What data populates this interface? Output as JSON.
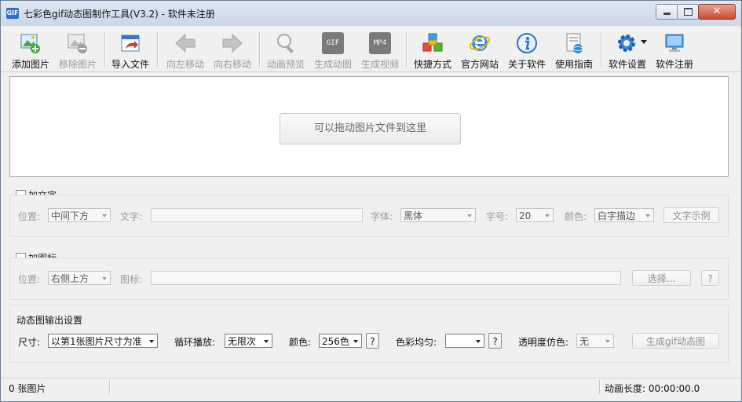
{
  "window": {
    "title": "七彩色gif动态图制作工具(V3.2) - 软件未注册",
    "app_icon_text": "GIF",
    "close_glyph": "✕"
  },
  "toolbar": {
    "items": [
      {
        "label": "添加图片",
        "icon": "add-image-icon"
      },
      {
        "label": "移除图片",
        "icon": "remove-image-icon"
      },
      {
        "label": "导入文件",
        "icon": "import-file-icon"
      },
      {
        "label": "向左移动",
        "icon": "arrow-left-icon"
      },
      {
        "label": "向右移动",
        "icon": "arrow-right-icon"
      },
      {
        "label": "动画预览",
        "icon": "magnifier-icon"
      },
      {
        "label": "生成动图",
        "icon": "gif-icon",
        "badge": "GIF"
      },
      {
        "label": "生成视频",
        "icon": "mp4-icon",
        "badge": "MP4"
      },
      {
        "label": "快捷方式",
        "icon": "cubes-icon"
      },
      {
        "label": "官方网站",
        "icon": "ie-browser-icon"
      },
      {
        "label": "关于软件",
        "icon": "info-icon"
      },
      {
        "label": "使用指南",
        "icon": "guide-icon"
      },
      {
        "label": "软件设置",
        "icon": "gear-icon"
      },
      {
        "label": "软件注册",
        "icon": "monitor-icon"
      }
    ]
  },
  "drop_area": {
    "button_label": "可以拖动图片文件到这里"
  },
  "text_section": {
    "checkbox_label": "加文字",
    "position_label": "位置:",
    "position_value": "中间下方",
    "text_label": "文字:",
    "font_label": "字体:",
    "font_value": "黑体",
    "size_label": "字号:",
    "size_value": "20",
    "color_label": "颜色:",
    "color_value": "白字描边",
    "sample_button": "文字示例"
  },
  "icon_section": {
    "checkbox_label": "加图标",
    "position_label": "位置:",
    "position_value": "右侧上方",
    "icon_label": "图标:",
    "choose_button": "选择...",
    "help_button": "?"
  },
  "output_section": {
    "title": "动态图输出设置",
    "size_label": "尺寸:",
    "size_value": "以第1张图片尺寸为准",
    "loop_label": "循环播放:",
    "loop_value": "无限次",
    "color_label": "颜色:",
    "color_value": "256色",
    "color_help": "?",
    "balance_label": "色彩均匀:",
    "balance_value": "",
    "balance_help": "?",
    "dither_label": "透明度仿色:",
    "dither_value": "无",
    "generate_button": "生成gif动态图"
  },
  "status_bar": {
    "image_count": "0 张图片",
    "duration_label": "动画长度: 00:00:00.0"
  },
  "colors": {
    "title_bar": "#dfe8f3",
    "close_button": "#c74a33",
    "app_icon": "#2f6fcf"
  }
}
